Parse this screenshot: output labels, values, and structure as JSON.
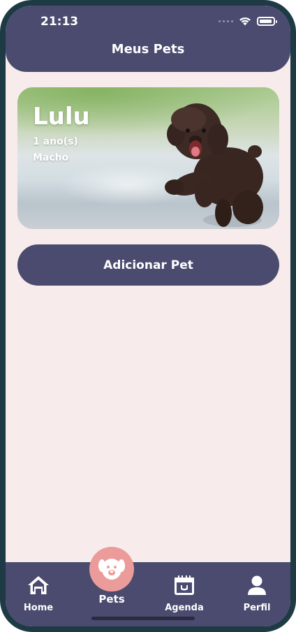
{
  "status_bar": {
    "time": "21:13"
  },
  "header": {
    "title": "Meus Pets"
  },
  "pets": [
    {
      "name": "Lulu",
      "age": "1 ano(s)",
      "sex": "Macho"
    }
  ],
  "add_button": {
    "label": "Adicionar Pet"
  },
  "tab_bar": {
    "items": [
      {
        "label": "Home",
        "icon": "home-icon"
      },
      {
        "label": "Pets",
        "icon": "dog-face-icon",
        "active": true
      },
      {
        "label": "Agenda",
        "icon": "calendar-icon"
      },
      {
        "label": "Perfil",
        "icon": "user-icon"
      }
    ]
  },
  "colors": {
    "primary": "#4a4b6e",
    "background": "#f7eceb",
    "accent": "#eb9c9a",
    "frame": "#1d3a45"
  }
}
